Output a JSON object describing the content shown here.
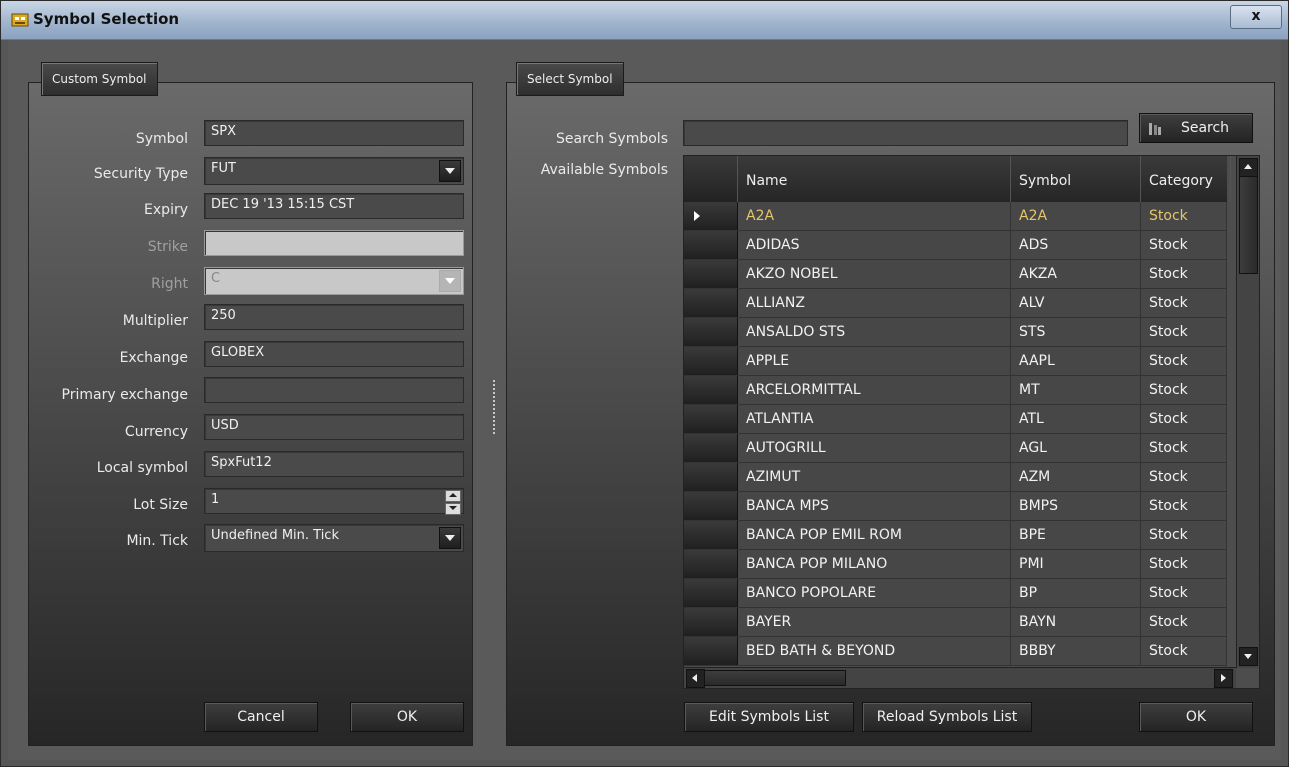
{
  "window": {
    "title": "Symbol Selection",
    "close_label": "x"
  },
  "custom_symbol": {
    "tab_label": "Custom Symbol",
    "fields": {
      "symbol": {
        "label": "Symbol",
        "value": "SPX"
      },
      "security_type": {
        "label": "Security Type",
        "value": "FUT"
      },
      "expiry": {
        "label": "Expiry",
        "value": "DEC 19 '13 15:15 CST"
      },
      "strike": {
        "label": "Strike",
        "value": ""
      },
      "right": {
        "label": "Right",
        "value": "C"
      },
      "multiplier": {
        "label": "Multiplier",
        "value": "250"
      },
      "exchange": {
        "label": "Exchange",
        "value": "GLOBEX"
      },
      "primary_exchange": {
        "label": "Primary exchange",
        "value": ""
      },
      "currency": {
        "label": "Currency",
        "value": "USD"
      },
      "local_symbol": {
        "label": "Local symbol",
        "value": "SpxFut12"
      },
      "lot_size": {
        "label": "Lot Size",
        "value": "1"
      },
      "min_tick": {
        "label": "Min. Tick",
        "value": "Undefined Min. Tick"
      }
    },
    "cancel_label": "Cancel",
    "ok_label": "OK"
  },
  "select_symbol": {
    "tab_label": "Select Symbol",
    "search_label": "Search Symbols",
    "search_value": "",
    "search_button": "Search",
    "available_label": "Available Symbols",
    "columns": [
      "Name",
      "Symbol",
      "Category"
    ],
    "rows": [
      {
        "name": "A2A",
        "symbol": "A2A",
        "category": "Stock"
      },
      {
        "name": "ADIDAS",
        "symbol": "ADS",
        "category": "Stock"
      },
      {
        "name": "AKZO NOBEL",
        "symbol": "AKZA",
        "category": "Stock"
      },
      {
        "name": "ALLIANZ",
        "symbol": "ALV",
        "category": "Stock"
      },
      {
        "name": "ANSALDO STS",
        "symbol": "STS",
        "category": "Stock"
      },
      {
        "name": "APPLE",
        "symbol": "AAPL",
        "category": "Stock"
      },
      {
        "name": "ARCELORMITTAL",
        "symbol": "MT",
        "category": "Stock"
      },
      {
        "name": "ATLANTIA",
        "symbol": "ATL",
        "category": "Stock"
      },
      {
        "name": "AUTOGRILL",
        "symbol": "AGL",
        "category": "Stock"
      },
      {
        "name": "AZIMUT",
        "symbol": "AZM",
        "category": "Stock"
      },
      {
        "name": "BANCA MPS",
        "symbol": "BMPS",
        "category": "Stock"
      },
      {
        "name": "BANCA POP EMIL ROM",
        "symbol": "BPE",
        "category": "Stock"
      },
      {
        "name": "BANCA POP MILANO",
        "symbol": "PMI",
        "category": "Stock"
      },
      {
        "name": "BANCO POPOLARE",
        "symbol": "BP",
        "category": "Stock"
      },
      {
        "name": "BAYER",
        "symbol": "BAYN",
        "category": "Stock"
      },
      {
        "name": "BED BATH & BEYOND",
        "symbol": "BBBY",
        "category": "Stock"
      }
    ],
    "edit_label": "Edit Symbols List",
    "reload_label": "Reload Symbols List",
    "ok_label": "OK"
  },
  "colors": {
    "selected_row_text": "#e6c66a",
    "accent_title": "#9fb3cc"
  }
}
